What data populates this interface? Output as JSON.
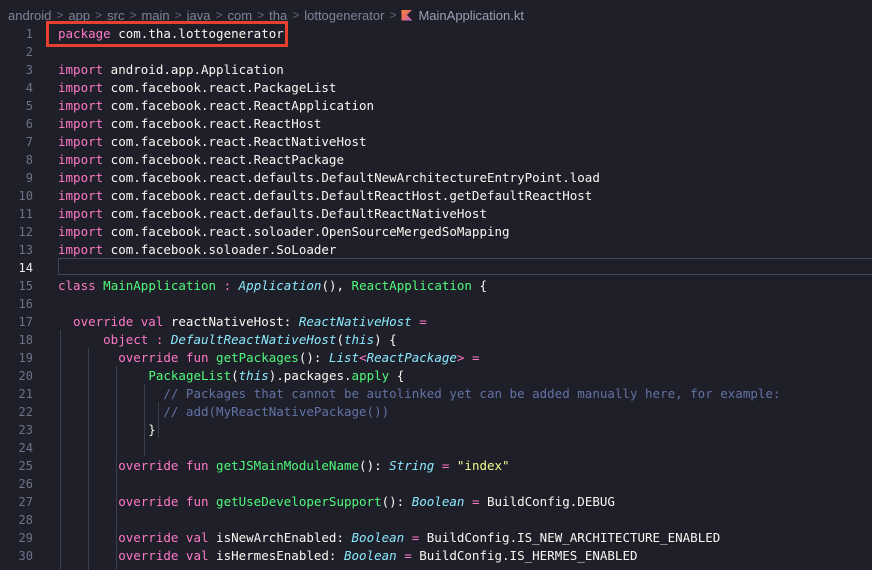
{
  "breadcrumb": {
    "items": [
      "android",
      "app",
      "src",
      "main",
      "java",
      "com",
      "tha",
      "lottogenerator"
    ],
    "separator": ">",
    "file": "MainApplication.kt",
    "file_icon": "kotlin-icon"
  },
  "editor": {
    "active_line": 14,
    "highlighted_line": 1,
    "highlight_color": "#e8402e",
    "lines": [
      {
        "n": "1",
        "tokens": [
          {
            "t": "package",
            "c": "k"
          },
          {
            "t": " com.tha.lottogenerator",
            "c": "p"
          }
        ]
      },
      {
        "n": "2",
        "tokens": []
      },
      {
        "n": "3",
        "tokens": [
          {
            "t": "import",
            "c": "k"
          },
          {
            "t": " android.app.Application",
            "c": "p"
          }
        ]
      },
      {
        "n": "4",
        "tokens": [
          {
            "t": "import",
            "c": "k"
          },
          {
            "t": " com.facebook.react.PackageList",
            "c": "p"
          }
        ]
      },
      {
        "n": "5",
        "tokens": [
          {
            "t": "import",
            "c": "k"
          },
          {
            "t": " com.facebook.react.ReactApplication",
            "c": "p"
          }
        ]
      },
      {
        "n": "6",
        "tokens": [
          {
            "t": "import",
            "c": "k"
          },
          {
            "t": " com.facebook.react.ReactHost",
            "c": "p"
          }
        ]
      },
      {
        "n": "7",
        "tokens": [
          {
            "t": "import",
            "c": "k"
          },
          {
            "t": " com.facebook.react.ReactNativeHost",
            "c": "p"
          }
        ]
      },
      {
        "n": "8",
        "tokens": [
          {
            "t": "import",
            "c": "k"
          },
          {
            "t": " com.facebook.react.ReactPackage",
            "c": "p"
          }
        ]
      },
      {
        "n": "9",
        "tokens": [
          {
            "t": "import",
            "c": "k"
          },
          {
            "t": " com.facebook.react.defaults.DefaultNewArchitectureEntryPoint.load",
            "c": "p"
          }
        ]
      },
      {
        "n": "10",
        "tokens": [
          {
            "t": "import",
            "c": "k"
          },
          {
            "t": " com.facebook.react.defaults.DefaultReactHost.getDefaultReactHost",
            "c": "p"
          }
        ]
      },
      {
        "n": "11",
        "tokens": [
          {
            "t": "import",
            "c": "k"
          },
          {
            "t": " com.facebook.react.defaults.DefaultReactNativeHost",
            "c": "p"
          }
        ]
      },
      {
        "n": "12",
        "tokens": [
          {
            "t": "import",
            "c": "k"
          },
          {
            "t": " com.facebook.react.soloader.OpenSourceMergedSoMapping",
            "c": "p"
          }
        ]
      },
      {
        "n": "13",
        "tokens": [
          {
            "t": "import",
            "c": "k"
          },
          {
            "t": " com.facebook.soloader.SoLoader",
            "c": "p"
          }
        ]
      },
      {
        "n": "14",
        "tokens": []
      },
      {
        "n": "15",
        "tokens": [
          {
            "t": "class",
            "c": "k"
          },
          {
            "t": " ",
            "c": "p"
          },
          {
            "t": "MainApplication",
            "c": "c"
          },
          {
            "t": " : ",
            "c": "k"
          },
          {
            "t": "Application",
            "c": "t"
          },
          {
            "t": "(), ",
            "c": "p"
          },
          {
            "t": "ReactApplication",
            "c": "c"
          },
          {
            "t": " {",
            "c": "p"
          }
        ]
      },
      {
        "n": "16",
        "tokens": []
      },
      {
        "n": "17",
        "tokens": [
          {
            "t": "  override val",
            "c": "k"
          },
          {
            "t": " reactNativeHost: ",
            "c": "p"
          },
          {
            "t": "ReactNativeHost",
            "c": "t"
          },
          {
            "t": " =",
            "c": "k"
          }
        ]
      },
      {
        "n": "18",
        "tokens": [
          {
            "t": "      object",
            "c": "k"
          },
          {
            "t": " : ",
            "c": "k"
          },
          {
            "t": "DefaultReactNativeHost",
            "c": "t"
          },
          {
            "t": "(",
            "c": "p"
          },
          {
            "t": "this",
            "c": "t"
          },
          {
            "t": ") {",
            "c": "p"
          }
        ]
      },
      {
        "n": "19",
        "tokens": [
          {
            "t": "        override fun",
            "c": "k"
          },
          {
            "t": " ",
            "c": "p"
          },
          {
            "t": "getPackages",
            "c": "c"
          },
          {
            "t": "(): ",
            "c": "p"
          },
          {
            "t": "List",
            "c": "t"
          },
          {
            "t": "<",
            "c": "k"
          },
          {
            "t": "ReactPackage",
            "c": "t"
          },
          {
            "t": "> =",
            "c": "k"
          }
        ]
      },
      {
        "n": "20",
        "tokens": [
          {
            "t": "            ",
            "c": "p"
          },
          {
            "t": "PackageList",
            "c": "c"
          },
          {
            "t": "(",
            "c": "p"
          },
          {
            "t": "this",
            "c": "t"
          },
          {
            "t": ").packages.",
            "c": "p"
          },
          {
            "t": "apply",
            "c": "c"
          },
          {
            "t": " {",
            "c": "p"
          }
        ]
      },
      {
        "n": "21",
        "tokens": [
          {
            "t": "              // Packages that cannot be autolinked yet can be added manually here, for example:",
            "c": "cm"
          }
        ]
      },
      {
        "n": "22",
        "tokens": [
          {
            "t": "              // add(MyReactNativePackage())",
            "c": "cm"
          }
        ]
      },
      {
        "n": "23",
        "tokens": [
          {
            "t": "            }",
            "c": "p"
          }
        ]
      },
      {
        "n": "24",
        "tokens": []
      },
      {
        "n": "25",
        "tokens": [
          {
            "t": "        override fun",
            "c": "k"
          },
          {
            "t": " ",
            "c": "p"
          },
          {
            "t": "getJSMainModuleName",
            "c": "c"
          },
          {
            "t": "(): ",
            "c": "p"
          },
          {
            "t": "String",
            "c": "t"
          },
          {
            "t": " = ",
            "c": "k"
          },
          {
            "t": "\"index\"",
            "c": "s"
          }
        ]
      },
      {
        "n": "26",
        "tokens": []
      },
      {
        "n": "27",
        "tokens": [
          {
            "t": "        override fun",
            "c": "k"
          },
          {
            "t": " ",
            "c": "p"
          },
          {
            "t": "getUseDeveloperSupport",
            "c": "c"
          },
          {
            "t": "(): ",
            "c": "p"
          },
          {
            "t": "Boolean",
            "c": "t"
          },
          {
            "t": " = ",
            "c": "k"
          },
          {
            "t": "BuildConfig.DEBUG",
            "c": "p"
          }
        ]
      },
      {
        "n": "28",
        "tokens": []
      },
      {
        "n": "29",
        "tokens": [
          {
            "t": "        override val",
            "c": "k"
          },
          {
            "t": " isNewArchEnabled: ",
            "c": "p"
          },
          {
            "t": "Boolean",
            "c": "t"
          },
          {
            "t": " = ",
            "c": "k"
          },
          {
            "t": "BuildConfig.IS_NEW_ARCHITECTURE_ENABLED",
            "c": "p"
          }
        ]
      },
      {
        "n": "30",
        "tokens": [
          {
            "t": "        override val",
            "c": "k"
          },
          {
            "t": " isHermesEnabled: ",
            "c": "p"
          },
          {
            "t": "Boolean",
            "c": "t"
          },
          {
            "t": " = ",
            "c": "k"
          },
          {
            "t": "BuildConfig.IS_HERMES_ENABLED",
            "c": "p"
          }
        ]
      }
    ]
  }
}
